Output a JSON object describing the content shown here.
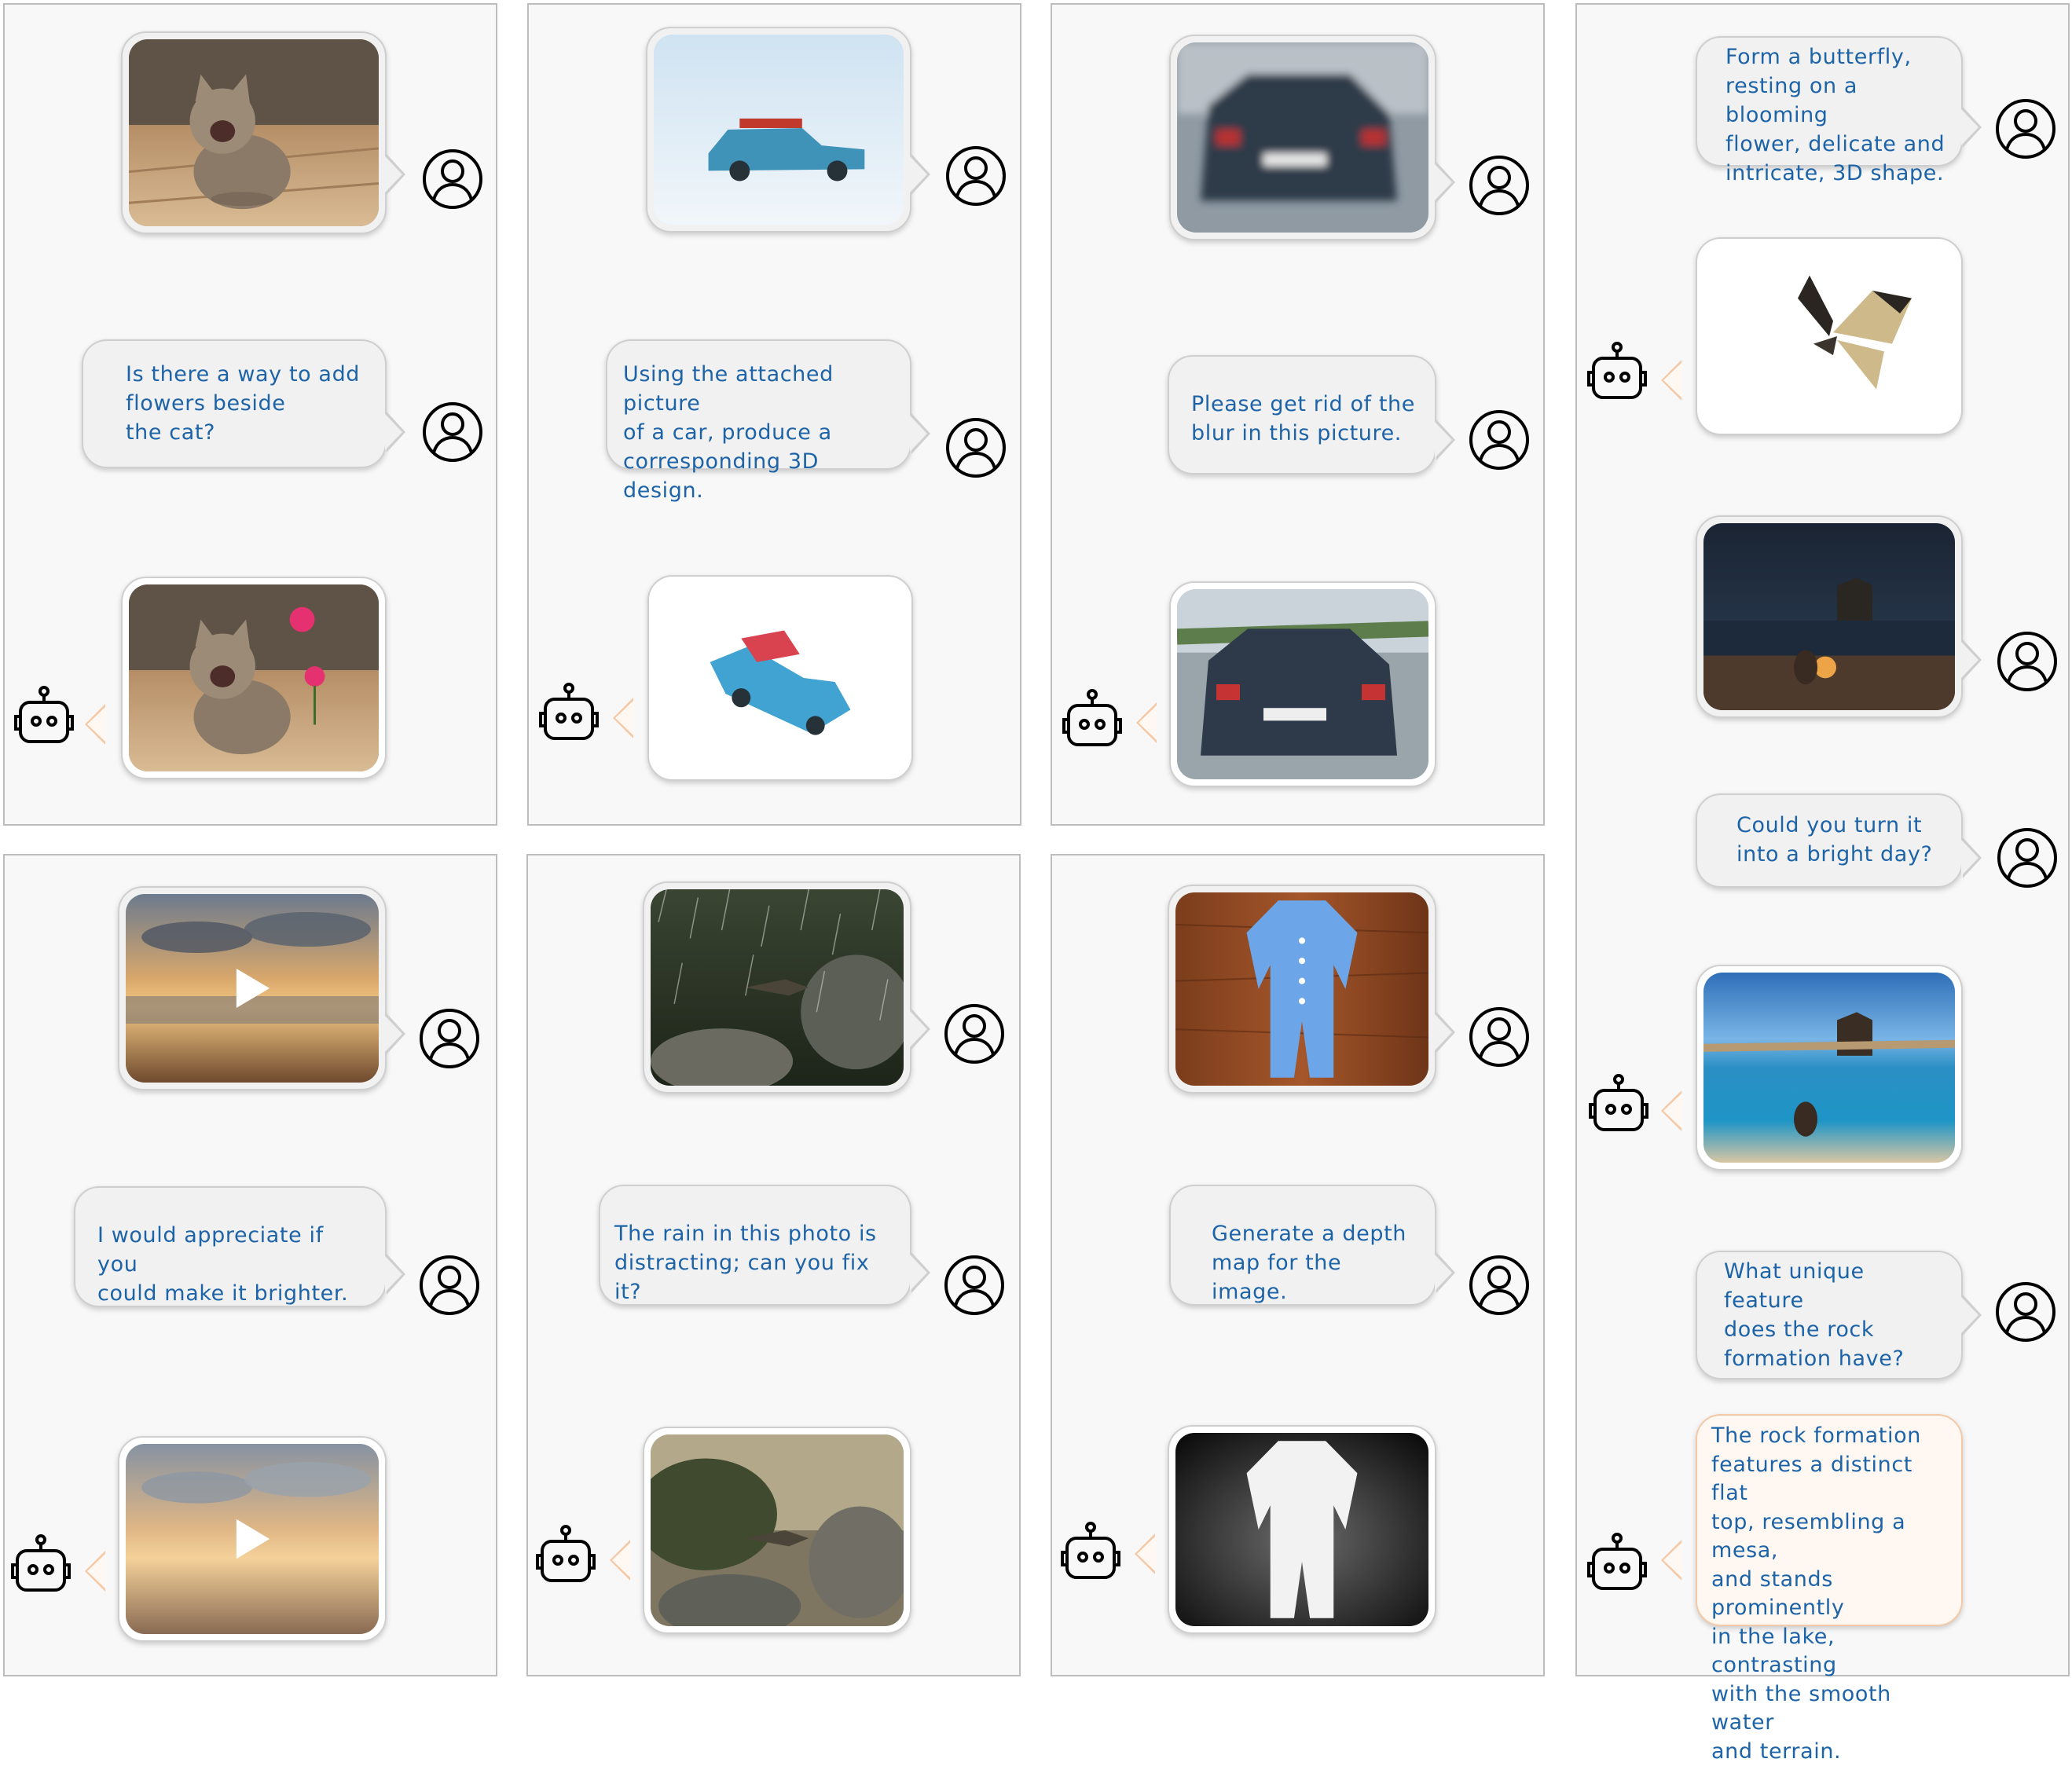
{
  "panels": [
    {
      "user_image": "kitten-photo",
      "user_text": "Is there a way to add\nflowers beside\nthe cat?",
      "bot_image": "kitten-with-flowers-photo"
    },
    {
      "user_image": "blue-car-photo",
      "user_text": "Using the attached picture\n of a car, produce a\ncorresponding 3D design.",
      "bot_image": "car-3d-model-render"
    },
    {
      "user_image": "blurry-car-photo",
      "user_text": "Please get rid of the\nblur in this picture.",
      "bot_image": "deblurred-car-photo"
    },
    {
      "user_image": "sunset-beach-video",
      "user_text": "I would appreciate if you\ncould make it brighter.",
      "bot_image": "brighter-sunset-video"
    },
    {
      "user_image": "bird-in-rain-photo",
      "user_text": "The rain in this photo is\ndistracting; can you fix it?",
      "bot_image": "bird-without-rain-photo"
    },
    {
      "user_image": "baby-onesie-photo",
      "user_text": "Generate a depth\nmap for the image.",
      "bot_image": "onesie-depth-map"
    }
  ],
  "tall_panel": {
    "turn1_user_text": "Form a butterfly,\nresting on a blooming\nflower, delicate and\nintricate, 3D shape.",
    "turn1_bot_image": "butterfly-3d-render",
    "turn2_user_image": "night-lake-campfire-photo",
    "turn2_user_text": "Could you turn it\ninto a bright day?",
    "turn2_bot_image": "daytime-lake-photo",
    "turn3_user_text": "What unique feature\ndoes the rock\nformation have?",
    "turn3_bot_text": "The rock formation\nfeatures a distinct flat\ntop, resembling a mesa,\nand stands prominently\nin the lake, contrasting\nwith the smooth water\nand terrain."
  },
  "icons": {
    "user": "user-avatar-icon",
    "bot": "robot-icon"
  },
  "colors": {
    "text": "#1d63a8",
    "panel_bg": "#f8f8f8",
    "bot_accent": "#f3c9a8"
  }
}
